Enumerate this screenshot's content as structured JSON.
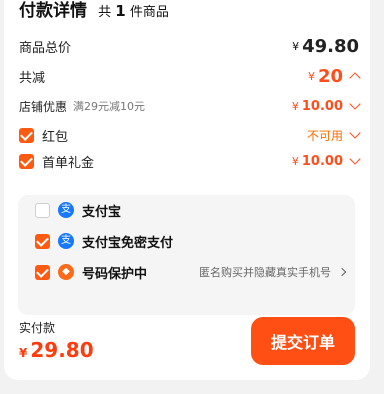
{
  "header": {
    "title": "付款详情",
    "count_prefix": "共",
    "count_number": "1",
    "count_suffix": "件商品"
  },
  "summary": {
    "total": {
      "label": "商品总价",
      "currency": "¥",
      "value": "49.80"
    },
    "discount": {
      "label": "共减",
      "currency": "¥",
      "value": "20"
    },
    "shop_coupon": {
      "label": "店铺优惠",
      "desc": "满29元减10元",
      "currency": "¥",
      "value": "10.00"
    },
    "red_packet": {
      "label": "红包",
      "status": "不可用"
    },
    "first_gift": {
      "label": "首单礼金",
      "currency": "¥",
      "value": "10.00"
    }
  },
  "payment": {
    "methods": [
      {
        "label": "支付宝",
        "checked": false,
        "icon": "alipay-icon"
      },
      {
        "label": "支付宝免密支付",
        "checked": true,
        "icon": "alipay-icon"
      }
    ],
    "privacy": {
      "label": "号码保护中",
      "note": "匿名购买并隐藏真实手机号",
      "checked": true,
      "icon": "shield-icon"
    }
  },
  "footer": {
    "label": "实付款",
    "currency": "¥",
    "amount": "29.80",
    "submit_label": "提交订单"
  },
  "colors": {
    "accent": "#ff4f14",
    "price_red": "#ff3c0f",
    "alipay_blue": "#1677ff"
  }
}
